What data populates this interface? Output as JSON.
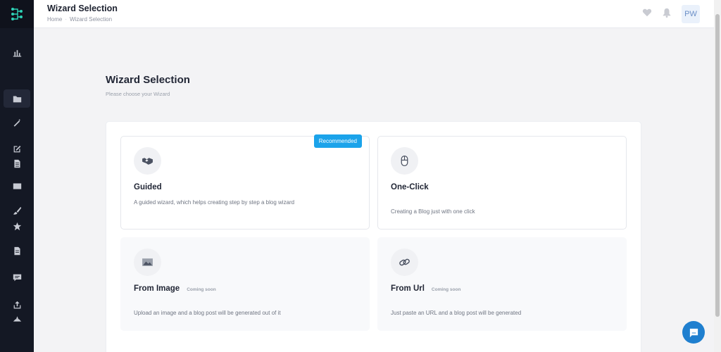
{
  "header": {
    "title": "Wizard Selection",
    "breadcrumb": [
      "Home",
      "Wizard Selection"
    ],
    "avatar_initials": "PW",
    "icons": [
      "heart-icon",
      "bell-icon"
    ]
  },
  "sidebar": {
    "icons": [
      "chart-icon",
      "folder-icon",
      "magic-wand-icon",
      "edit-icon",
      "document-list-icon",
      "image-icon",
      "brush-icon",
      "star-icon",
      "document-icon",
      "message-icon",
      "upload-icon",
      "cloud-icon"
    ],
    "active": "folder-icon"
  },
  "main": {
    "heading": "Wizard Selection",
    "subheading": "Please choose your Wizard"
  },
  "wizards": [
    {
      "title": "Guided",
      "description": "A guided wizard, which helps creating step by step a blog wizard",
      "badge": "Recommended",
      "icon": "handshake-icon",
      "status": ""
    },
    {
      "title": "One-Click",
      "description": "Creating a Blog just with one click",
      "badge": "",
      "icon": "mouse-icon",
      "status": ""
    },
    {
      "title": "From Image",
      "description": "Upload an image and a blog post will be generated out of it",
      "badge": "",
      "icon": "image-icon",
      "status": "Coming soon"
    },
    {
      "title": "From Url",
      "description": "Just paste an URL and a blog post will be generated",
      "badge": "",
      "icon": "link-icon",
      "status": "Coming soon"
    }
  ],
  "colors": {
    "accent": "#1ba3ea",
    "sidebar": "#141824",
    "chat": "#1f7fcf"
  }
}
